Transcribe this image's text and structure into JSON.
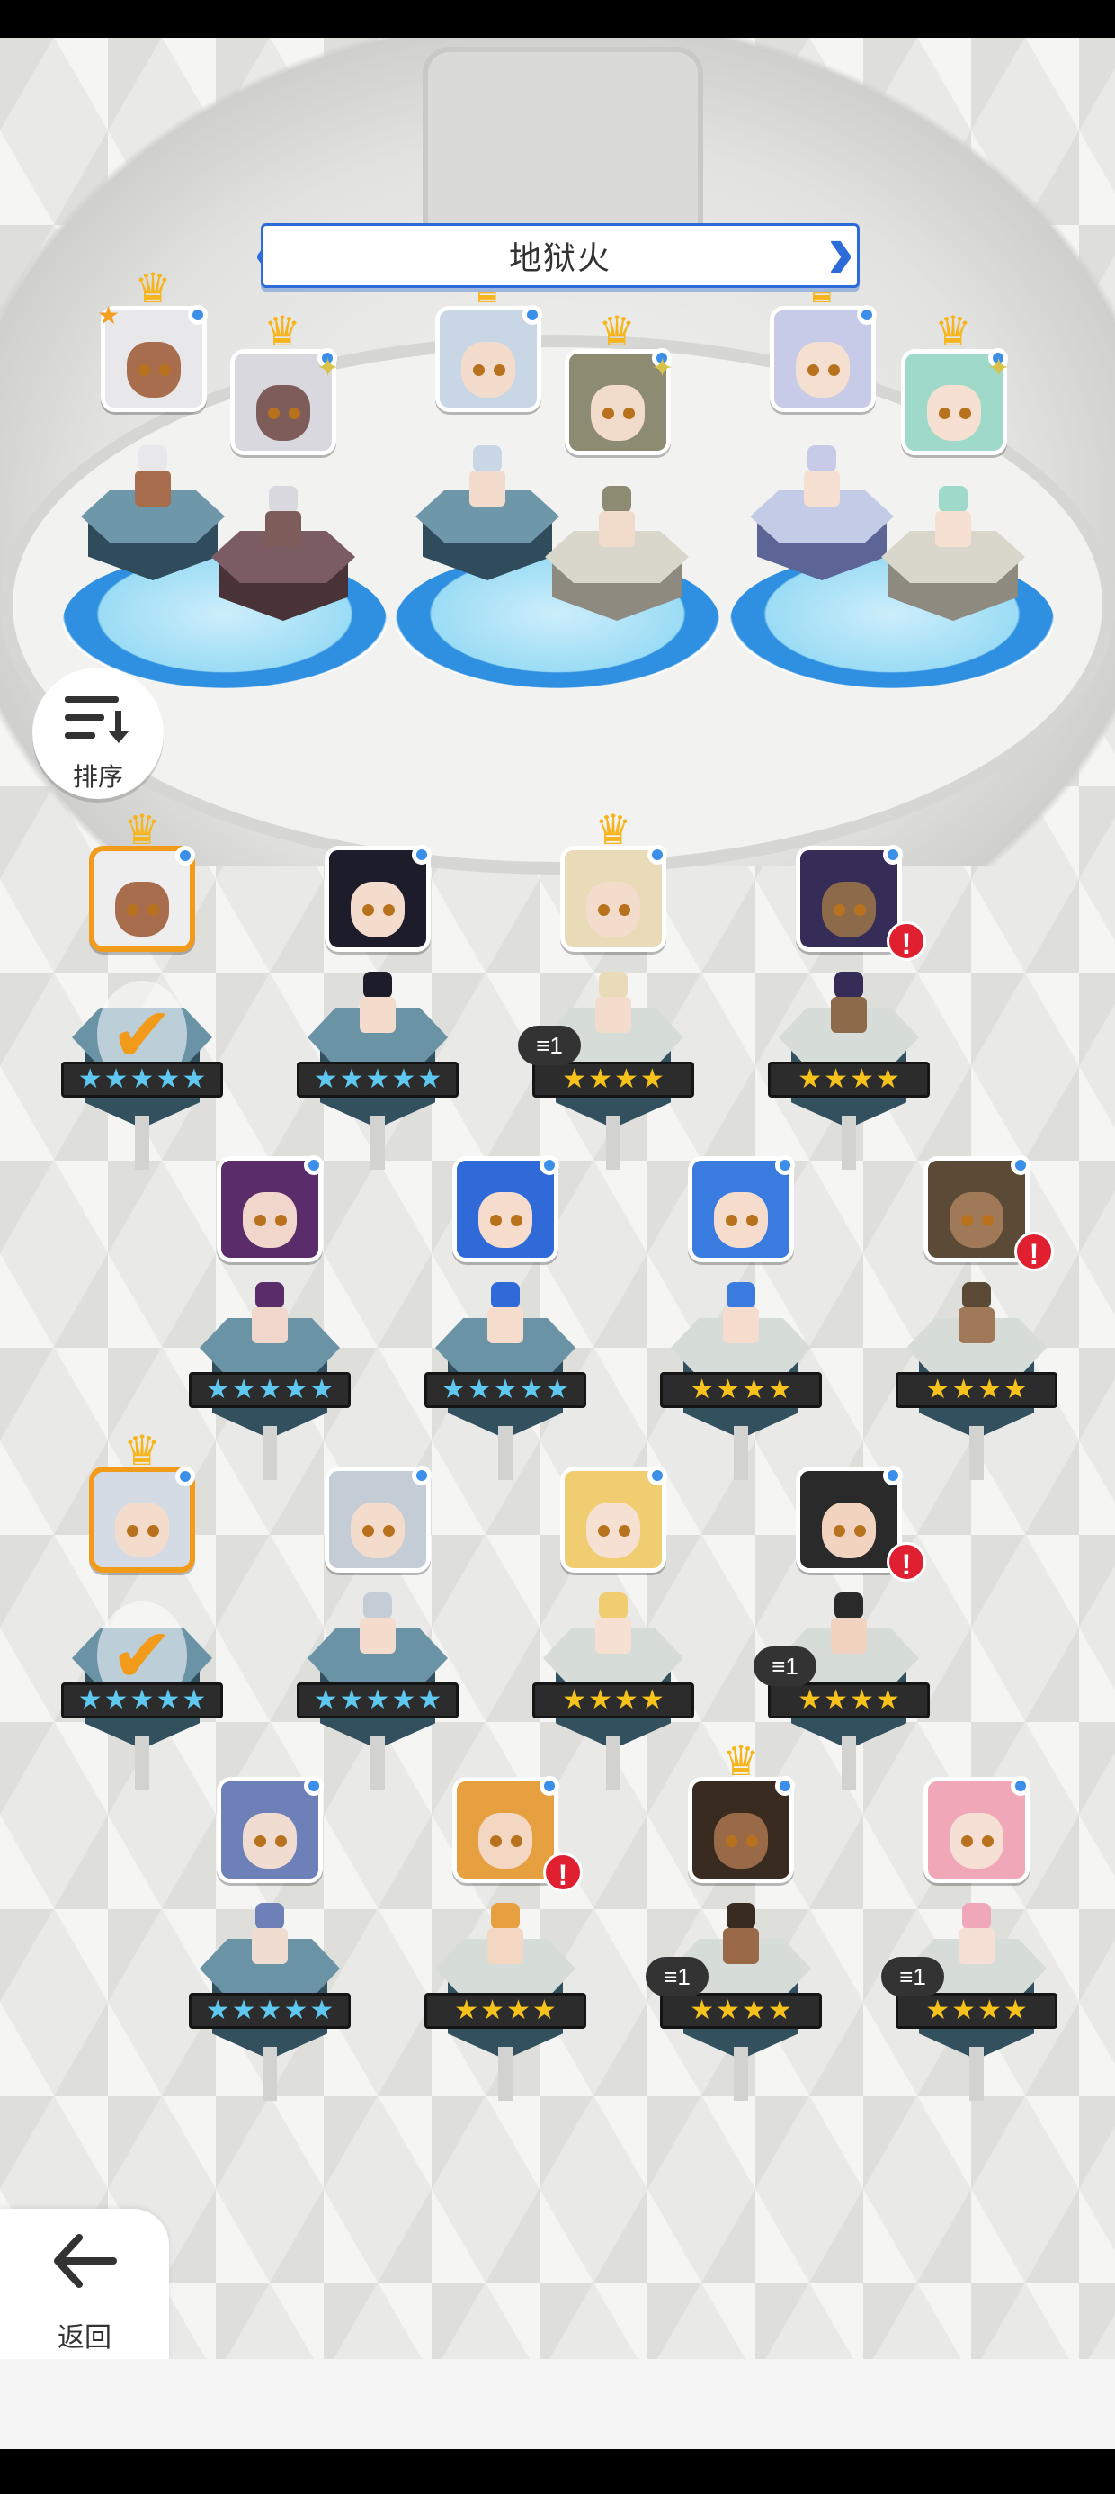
{
  "arena": {
    "title": "地狱火"
  },
  "sort": {
    "label": "排序"
  },
  "back": {
    "label": "返回"
  },
  "colors": {
    "accent": "#2d6cd8",
    "selected": "#f29a1a",
    "alert": "#e02030",
    "star5": "#5ec8f0",
    "star4": "#f7c21c"
  },
  "slots": [
    {
      "hair": "#e8e8ea",
      "skin": "#a86d4c",
      "pedestal": "teal",
      "crown": true,
      "star": true
    },
    {
      "hair": "#d8d8de",
      "skin": "#7e5c5a",
      "pedestal": "purple",
      "crown": true,
      "sparkle": true
    },
    {
      "hair": "#c9d6e6",
      "skin": "#f4dccd",
      "pedestal": "teal",
      "crown": true
    },
    {
      "hair": "#8d8b72",
      "skin": "#f1dccc",
      "pedestal": "beige",
      "crown": true,
      "sparkle": true
    },
    {
      "hair": "#c8cbe8",
      "skin": "#f5dfd1",
      "pedestal": "lav",
      "crown": true
    },
    {
      "hair": "#9fd9c9",
      "skin": "#f6e0d2",
      "pedestal": "beige",
      "crown": true,
      "sparkle": true
    }
  ],
  "roster": [
    {
      "hair": "#eeeeee",
      "skin": "#a86d4c",
      "stars": 5,
      "crown": true,
      "selected": true,
      "deployed": true
    },
    {
      "hair": "#1d1c2a",
      "skin": "#f4dccd",
      "stars": 5
    },
    {
      "hair": "#eadbb8",
      "skin": "#f4dccd",
      "stars": 4,
      "crown": true,
      "copies": "1"
    },
    {
      "hair": "#352c58",
      "skin": "#8c6a4a",
      "stars": 4,
      "alert": true
    },
    {
      "hair": "#5a2c6a",
      "skin": "#f1d6cc",
      "stars": 5
    },
    {
      "hair": "#2f6ad8",
      "skin": "#f6dccd",
      "stars": 5
    },
    {
      "hair": "#3a7be0",
      "skin": "#f6dccd",
      "stars": 4
    },
    {
      "hair": "#5b4a36",
      "skin": "#a07a58",
      "stars": 4,
      "alert": true
    },
    {
      "hair": "#d5dbe4",
      "skin": "#f4dccd",
      "stars": 5,
      "crown": true,
      "selected": true,
      "deployed": true
    },
    {
      "hair": "#c4ccd6",
      "skin": "#f4dccd",
      "stars": 5
    },
    {
      "hair": "#f0cd70",
      "skin": "#f6e0d2",
      "stars": 4
    },
    {
      "hair": "#2a2a2a",
      "skin": "#f1d3c0",
      "stars": 4,
      "alert": true,
      "copies": "1"
    },
    {
      "hair": "#6d80b8",
      "skin": "#f1dcd2",
      "stars": 5
    },
    {
      "hair": "#e6a040",
      "skin": "#f4d7c2",
      "stars": 4,
      "alert": true
    },
    {
      "hair": "#3a2b20",
      "skin": "#9a6a48",
      "stars": 4,
      "crown": true,
      "copies": "1"
    },
    {
      "hair": "#f0a8b8",
      "skin": "#f6e0d6",
      "stars": 4,
      "copies": "1"
    }
  ]
}
